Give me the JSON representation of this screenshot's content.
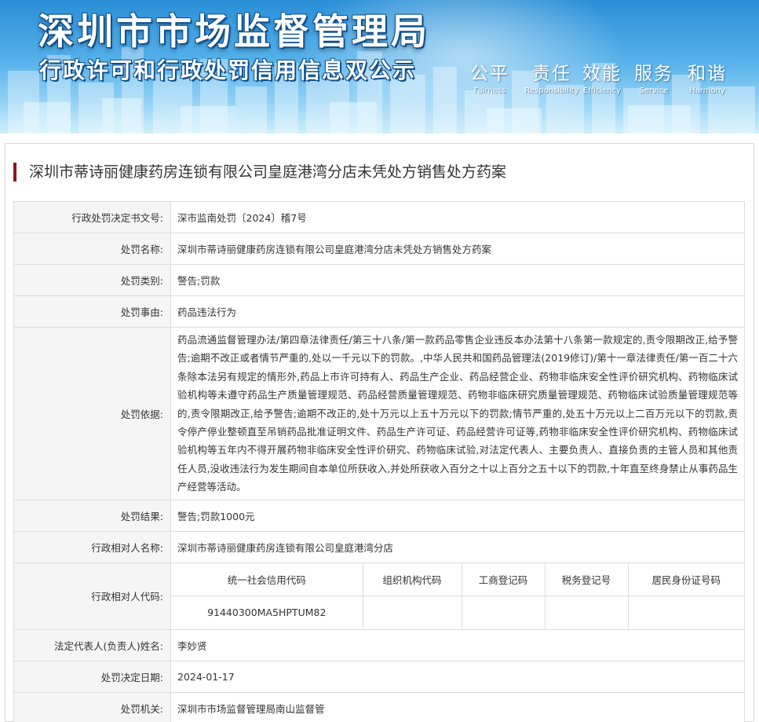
{
  "banner": {
    "title": "深圳市市场监督管理局",
    "subtitle": "行政许可和行政处罚信用信息双公示",
    "slogans": [
      {
        "zh": "公平",
        "en": "Fairness"
      },
      {
        "zh": "责任",
        "en": "Responsibility"
      },
      {
        "zh": "效能",
        "en": "Efficiency"
      },
      {
        "zh": "服务",
        "en": "Service"
      },
      {
        "zh": "和谐",
        "en": "Harmony"
      }
    ]
  },
  "page": {
    "title": "深圳市蒂诗丽健康药房连锁有限公司皇庭港湾分店未凭处方销售处方药案"
  },
  "fields": {
    "decision_no": {
      "label": "行政处罚决定书文号:",
      "value": "深市监南处罚〔2024〕稽7号"
    },
    "penalty_name": {
      "label": "处罚名称:",
      "value": "深圳市蒂诗丽健康药房连锁有限公司皇庭港湾分店未凭处方销售处方药案"
    },
    "penalty_type": {
      "label": "处罚类别:",
      "value": "警告;罚款"
    },
    "penalty_reason": {
      "label": "处罚事由:",
      "value": "药品违法行为"
    },
    "penalty_basis": {
      "label": "处罚依据:",
      "value": "药品流通监督管理办法/第四章法律责任/第三十八条/第一款药品零售企业违反本办法第十八条第一款规定的,责令限期改正,给予警告;逾期不改正或者情节严重的,处以一千元以下的罚款。,中华人民共和国药品管理法(2019修订)/第十一章法律责任/第一百二十六条除本法另有规定的情形外,药品上市许可持有人、药品生产企业、药品经营企业、药物非临床安全性评价研究机构、药物临床试验机构等未遵守药品生产质量管理规范、药品经营质量管理规范、药物非临床研究质量管理规范、药物临床试验质量管理规范等的,责令限期改正,给予警告;逾期不改正的,处十万元以上五十万元以下的罚款;情节严重的,处五十万元以上二百万元以下的罚款,责令停产停业整顿直至吊销药品批准证明文件、药品生产许可证、药品经营许可证等,药物非临床安全性评价研究机构、药物临床试验机构等五年内不得开展药物非临床安全性评价研究、药物临床试验,对法定代表人、主要负责人、直接负责的主管人员和其他责任人员,没收违法行为发生期间自本单位所获收入,并处所获收入百分之十以上百分之五十以下的罚款,十年直至终身禁止从事药品生产经营等活动。"
    },
    "penalty_result": {
      "label": "处罚结果:",
      "value": "警告;罚款1000元"
    },
    "party_name": {
      "label": "行政相对人名称:",
      "value": "深圳市蒂诗丽健康药房连锁有限公司皇庭港湾分店"
    },
    "party_code": {
      "label": "行政相对人代码:",
      "headers": [
        "统一社会信用代码",
        "组织机构代码",
        "工商登记码",
        "税务登记号",
        "居民身份证号码"
      ],
      "values": [
        "91440300MA5HPTUM82",
        "",
        "",
        "",
        ""
      ]
    },
    "legal_rep": {
      "label": "法定代表人(负责人)姓名:",
      "value": "李妙贤"
    },
    "decision_date": {
      "label": "处罚决定日期:",
      "value": "2024-01-17"
    },
    "authority": {
      "label": "处罚机关:",
      "value": "深圳市市场监督管理局南山监督管"
    }
  }
}
